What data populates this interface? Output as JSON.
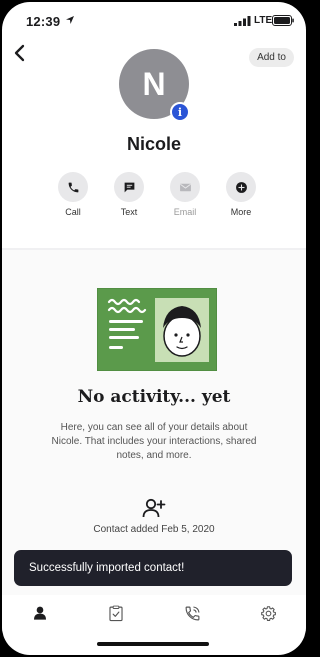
{
  "status_bar": {
    "time": "12:39",
    "network": "LTE"
  },
  "header": {
    "add_label": "Add to"
  },
  "contact": {
    "initial": "N",
    "name": "Nicole",
    "info_badge": "i"
  },
  "actions": [
    {
      "label": "Call",
      "icon": "phone-icon",
      "enabled": true
    },
    {
      "label": "Text",
      "icon": "chat-bubble-icon",
      "enabled": true
    },
    {
      "label": "Email",
      "icon": "mail-icon",
      "enabled": false
    },
    {
      "label": "More",
      "icon": "plus-circle-icon",
      "enabled": true
    }
  ],
  "activity": {
    "title": "No activity... yet",
    "body": "Here, you can see all of your details about Nicole. That includes your interactions, shared notes, and more.",
    "contact_added": "Contact added Feb 5, 2020"
  },
  "toast": {
    "message": "Successfully imported contact!"
  },
  "tabs": [
    {
      "name": "profile",
      "icon": "person-icon",
      "active": true
    },
    {
      "name": "notes",
      "icon": "clipboard-check-icon",
      "active": false
    },
    {
      "name": "calls",
      "icon": "phone-history-icon",
      "active": false
    },
    {
      "name": "settings",
      "icon": "gear-icon",
      "active": false
    }
  ],
  "colors": {
    "badge": "#2b55d6",
    "avatar": "#8e8e93",
    "illustration_green": "#5b9a4b",
    "toast_bg": "#20212b"
  }
}
